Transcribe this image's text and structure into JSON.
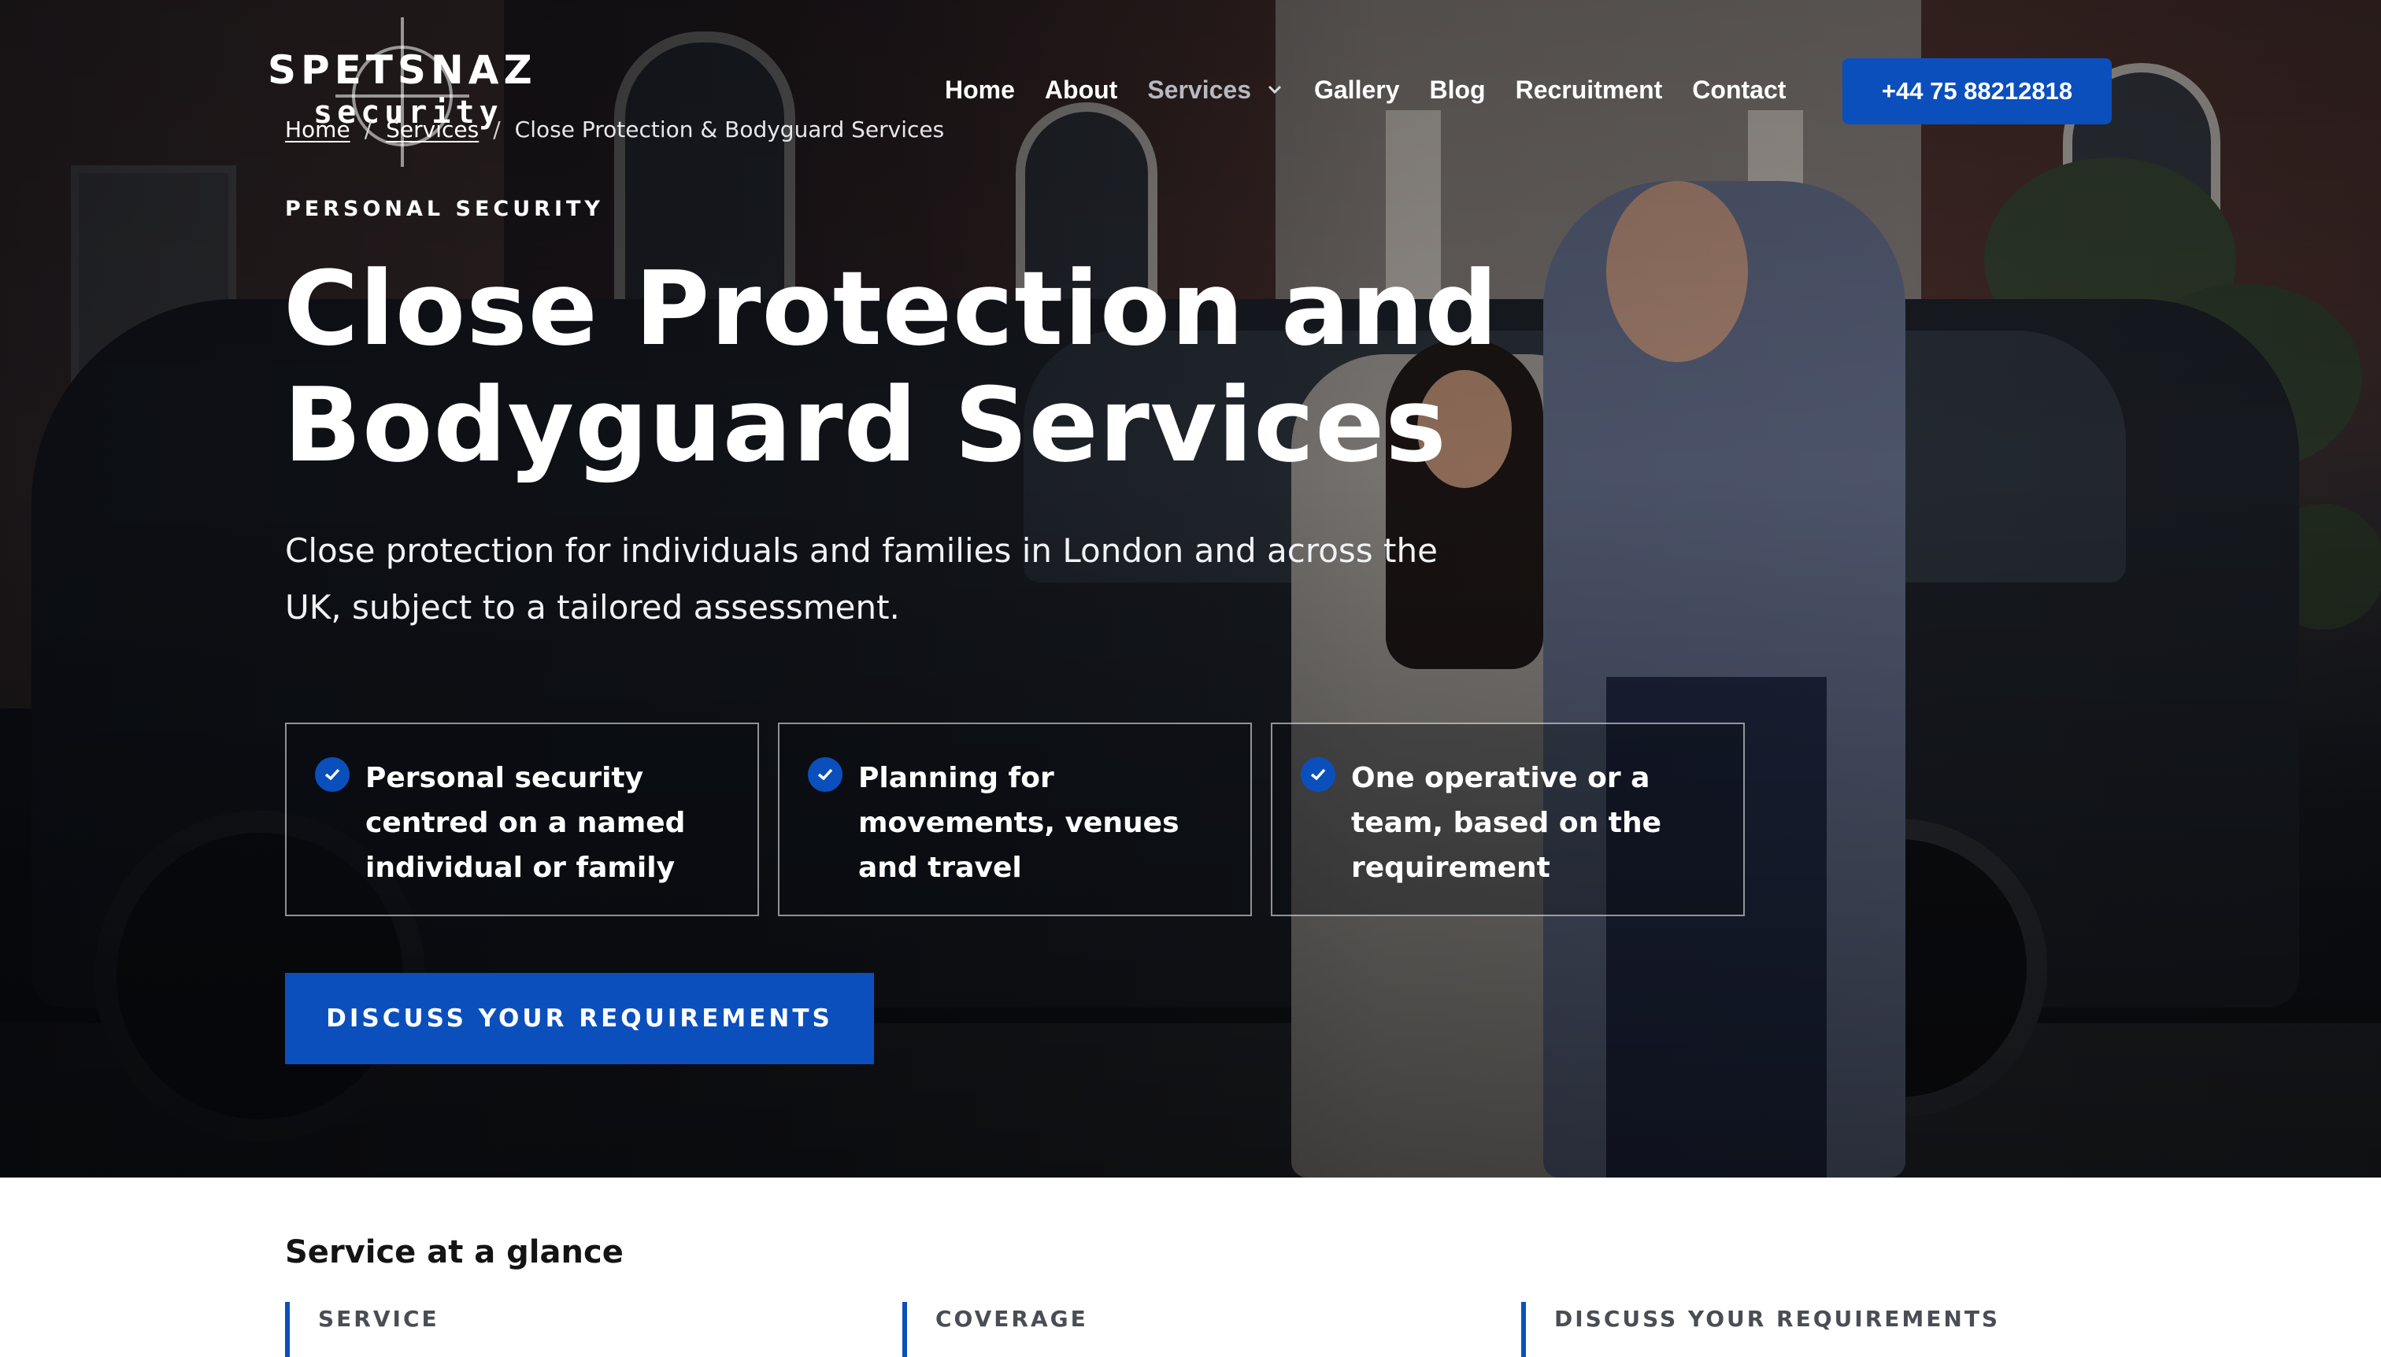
{
  "brand": {
    "name": "SPETSNAZ",
    "sub": "security"
  },
  "nav": {
    "items": [
      "Home",
      "About",
      "Services",
      "Gallery",
      "Blog",
      "Recruitment",
      "Contact"
    ],
    "phone": "+44 75 88212818"
  },
  "breadcrumb": {
    "home": "Home",
    "services": "Services",
    "current": "Close Protection & Bodyguard Services",
    "separator": "/"
  },
  "hero": {
    "eyebrow": "PERSONAL SECURITY",
    "title_line1": "Close Protection and",
    "title_line2": "Bodyguard Services",
    "lede": "Close protection for individuals and families in London and across the UK, subject to a tailored assessment.",
    "features": [
      "Personal security centred on a named individual or family",
      "Planning for movements, venues and travel",
      "One operative or a team, based on the requirement"
    ],
    "cta": "DISCUSS YOUR REQUIREMENTS"
  },
  "glance": {
    "title": "Service at a glance",
    "columns": [
      "SERVICE",
      "COVERAGE",
      "DISCUSS YOUR REQUIREMENTS"
    ]
  },
  "colors": {
    "accent": "#0b4fbd",
    "text_dark": "#141414"
  },
  "icons": {
    "check": "check-icon",
    "chevron": "chevron-down-icon",
    "logo_mark": "crosshair-icon"
  }
}
